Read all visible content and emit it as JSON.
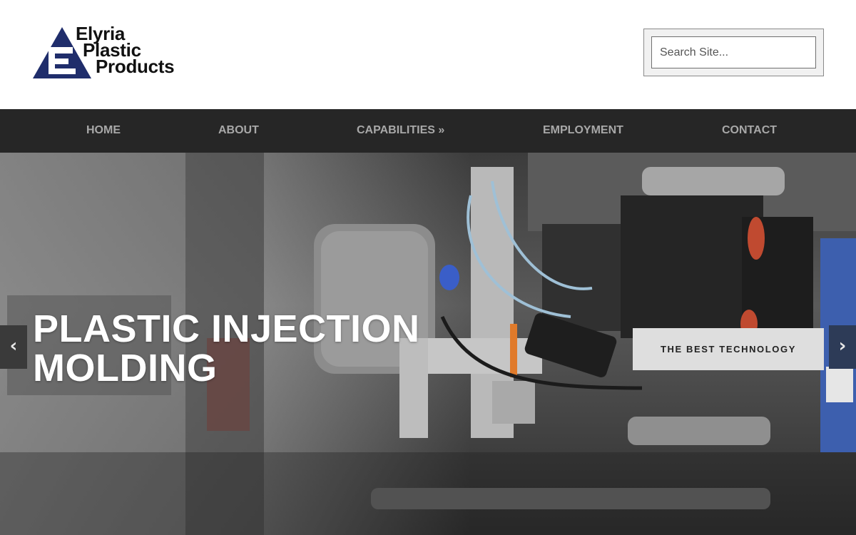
{
  "logo": {
    "line1": "Elyria",
    "line2": "Plastic",
    "line3": "Products",
    "brand_color": "#1f2d6b"
  },
  "search": {
    "placeholder": "Search Site..."
  },
  "nav": {
    "items": [
      {
        "label": "HOME"
      },
      {
        "label": "ABOUT"
      },
      {
        "label": "CAPABILITIES »"
      },
      {
        "label": "EMPLOYMENT"
      },
      {
        "label": "CONTACT"
      }
    ],
    "background": "#262626",
    "text_color": "#a8a8a8"
  },
  "hero": {
    "title_line1": "PLASTIC INJECTION",
    "title_line2": "MOLDING",
    "cta_label": "THE BEST TECHNOLOGY",
    "prev_icon": "chevron-left-icon",
    "next_icon": "chevron-right-icon",
    "prev_glyph": "‹",
    "next_glyph": "›"
  }
}
